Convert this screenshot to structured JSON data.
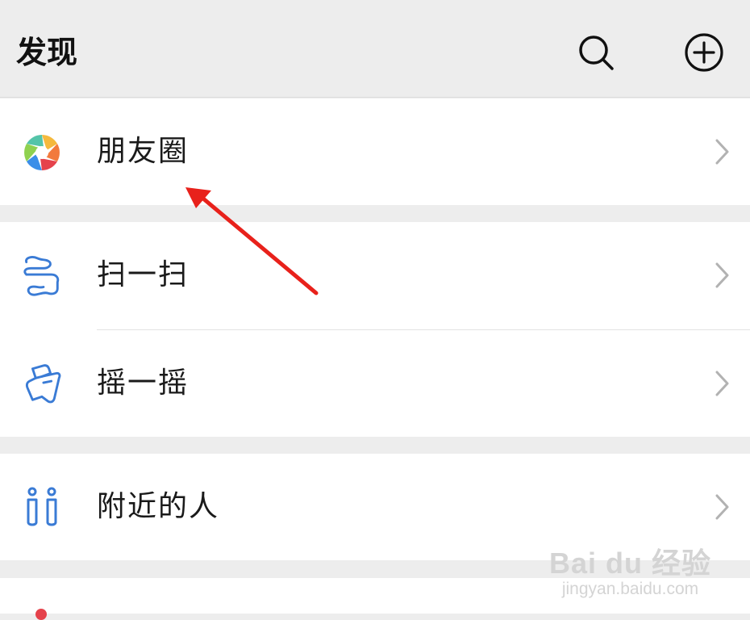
{
  "header": {
    "title": "发现",
    "search_icon": "search-icon",
    "add_icon": "plus-circle-icon"
  },
  "menu": {
    "moments": {
      "label": "朋友圈",
      "icon": "moments-aperture-icon"
    },
    "scan": {
      "label": "扫一扫",
      "icon": "scan-icon"
    },
    "shake": {
      "label": "摇一摇",
      "icon": "shake-icon"
    },
    "nearby": {
      "label": "附近的人",
      "icon": "nearby-people-icon"
    }
  },
  "annotation": {
    "arrow_color": "#e8211b"
  },
  "watermark": {
    "main": "Bai du 经验",
    "sub": "jingyan.baidu.com"
  },
  "colors": {
    "background": "#ededed",
    "card": "#ffffff",
    "icon_blue": "#3a7bd5",
    "chevron": "#b2b2b2"
  }
}
